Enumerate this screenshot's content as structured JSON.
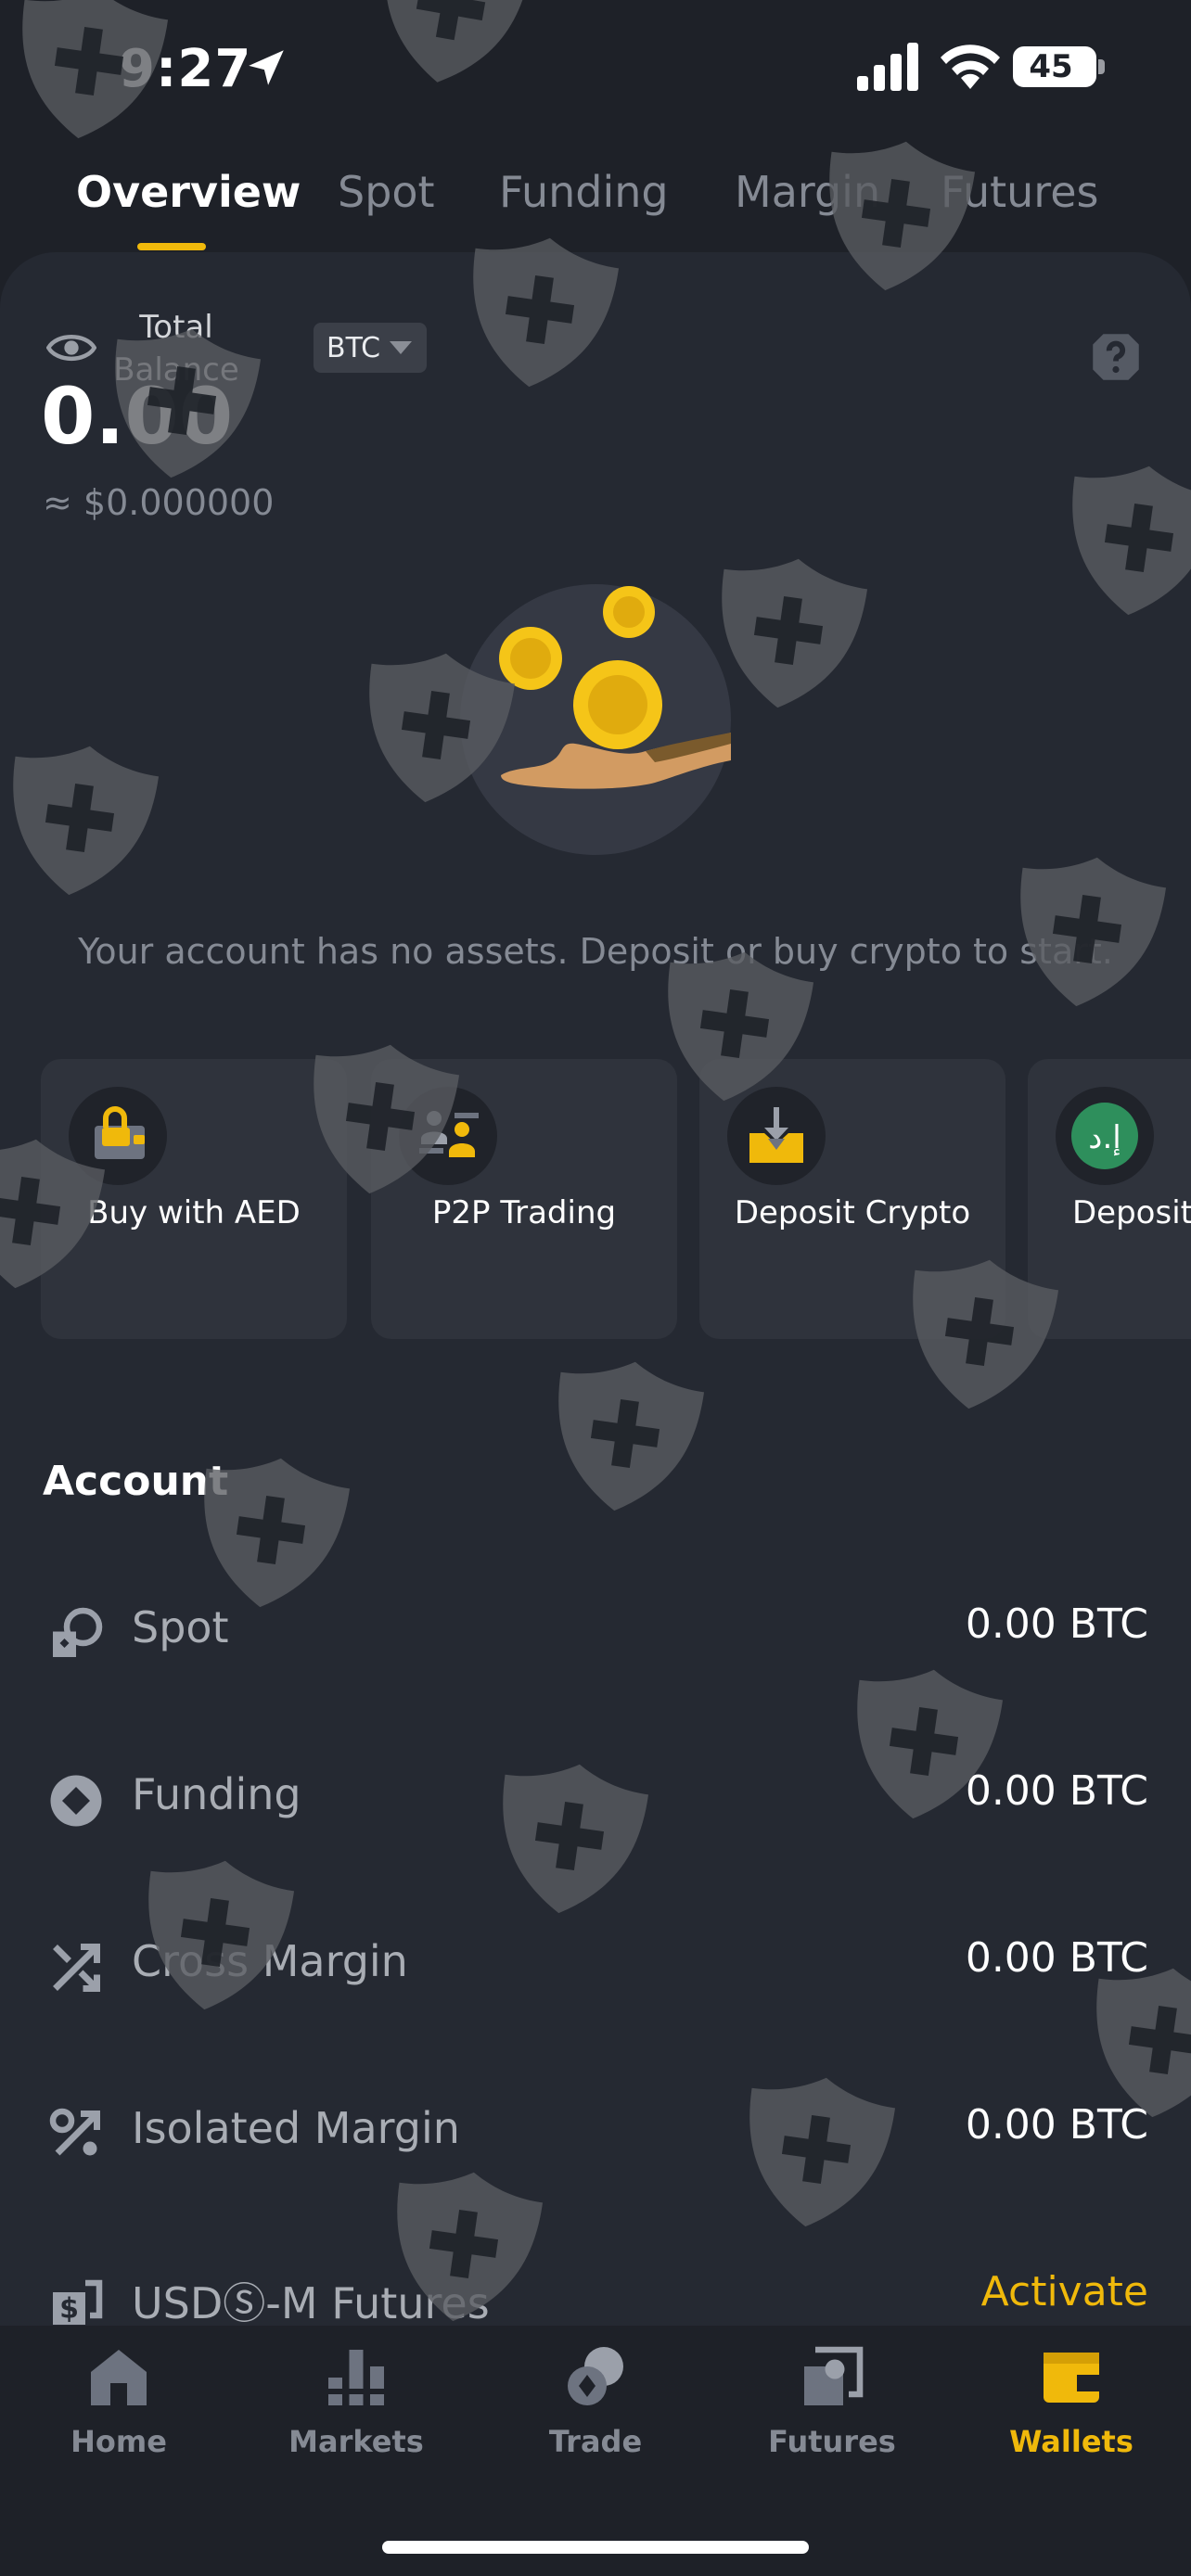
{
  "status_bar": {
    "time": "9:27",
    "battery": "45"
  },
  "tabs": [
    {
      "label": "Overview"
    },
    {
      "label": "Spot"
    },
    {
      "label": "Funding"
    },
    {
      "label": "Margin"
    },
    {
      "label": "Futures"
    }
  ],
  "balance": {
    "label": "Total Balance",
    "currency": "BTC",
    "value": "0.00",
    "fiat": "≈ $0.000000"
  },
  "empty_message": "Your account has no assets. Deposit or buy crypto to start.",
  "actions": [
    {
      "label": "Buy with AED",
      "icon": "wallet-lock-icon"
    },
    {
      "label": "P2P Trading",
      "icon": "p2p-users-icon"
    },
    {
      "label": "Deposit Crypto",
      "icon": "deposit-tray-icon"
    },
    {
      "label": "Deposit",
      "icon": "aed-coin-icon"
    }
  ],
  "account": {
    "title": "Account",
    "rows": [
      {
        "label": "Spot",
        "value": "0.00 BTC",
        "icon": "spot-icon"
      },
      {
        "label": "Funding",
        "value": "0.00 BTC",
        "icon": "funding-icon"
      },
      {
        "label": "Cross Margin",
        "value": "0.00 BTC",
        "icon": "cross-margin-icon"
      },
      {
        "label": "Isolated Margin",
        "value": "0.00 BTC",
        "icon": "isolated-margin-icon"
      },
      {
        "label": "USDⓈ-M Futures",
        "value": "Activate",
        "icon": "usd-futures-icon"
      }
    ]
  },
  "nav": [
    {
      "label": "Home",
      "icon": "home-icon"
    },
    {
      "label": "Markets",
      "icon": "markets-icon"
    },
    {
      "label": "Trade",
      "icon": "trade-icon"
    },
    {
      "label": "Futures",
      "icon": "futures-icon"
    },
    {
      "label": "Wallets",
      "icon": "wallet-icon"
    }
  ],
  "colors": {
    "accent": "#f0b90b",
    "background": "#1e2128",
    "card": "#252932"
  }
}
